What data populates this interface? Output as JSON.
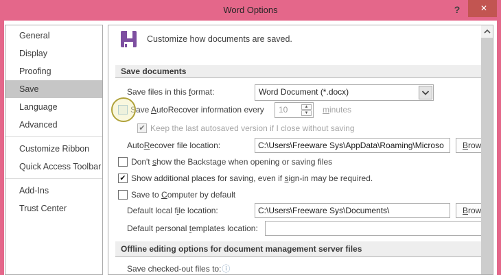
{
  "window": {
    "title": "Word Options"
  },
  "icons": {
    "help": "?",
    "close": "✕",
    "info": "ⓘ",
    "check": "✔",
    "spinner_up": "▲",
    "spinner_down": "▼"
  },
  "colors": {
    "titlebar_pink": "#e4678a",
    "close_button_red": "#c25551",
    "save_icon_purple": "#7d4fa0",
    "selected_item_gray": "#c6c6c6",
    "section_bar_gray": "#eeeeee",
    "highlight_circle_border": "#b0a23a",
    "highlight_circle_fill": "#f4f0c3",
    "highlighted_checkbox_border": "#6ba7d9"
  },
  "sidebar": {
    "items": [
      {
        "label": "General",
        "selected": false
      },
      {
        "label": "Display",
        "selected": false
      },
      {
        "label": "Proofing",
        "selected": false
      },
      {
        "label": "Save",
        "selected": true
      },
      {
        "label": "Language",
        "selected": false
      },
      {
        "label": "Advanced",
        "selected": false
      },
      {
        "label": "Customize Ribbon",
        "selected": false
      },
      {
        "label": "Quick Access Toolbar",
        "selected": false
      },
      {
        "label": "Add-Ins",
        "selected": false
      },
      {
        "label": "Trust Center",
        "selected": false
      }
    ]
  },
  "content": {
    "page_header": "Customize how documents are saved.",
    "save_section": {
      "title": "Save documents",
      "format_label": {
        "pre": "Save files in this ",
        "key": "f",
        "post": "ormat:"
      },
      "format_value": "Word Document (*.docx)",
      "autorecover": {
        "pre": "Save ",
        "key": "A",
        "post": "utoRecover information every",
        "value": "10",
        "minutes_key": "m",
        "minutes_post": "inutes",
        "checked": false
      },
      "keep_autosave_label": "Keep the last autosaved version if I close without saving",
      "keep_autosave_checked": true,
      "ar_location": {
        "pre": "Auto",
        "key": "R",
        "post": "ecover file location:",
        "value": "C:\\Users\\Freeware Sys\\AppData\\Roaming\\Microso"
      },
      "browse_button": {
        "key": "B",
        "post": "rowse..."
      },
      "backstage": {
        "pre": "Don't ",
        "key": "s",
        "post": "how the Backstage when opening or saving files",
        "checked": false
      },
      "places": {
        "pre": "Show additional places for saving, even if ",
        "key": "s",
        "post": "ign-in may be required.",
        "checked": true
      },
      "computer": {
        "pre": "Save to ",
        "key": "C",
        "post": "omputer by default",
        "checked": false
      },
      "local_location": {
        "pre": "Default local f",
        "key": "i",
        "post": "le location:",
        "value": "C:\\Users\\Freeware Sys\\Documents\\"
      },
      "templates_location": {
        "pre": "Default personal ",
        "key": "t",
        "post": "emplates location:",
        "value": ""
      }
    },
    "offline_section": {
      "title": "Offline editing options for document management server files",
      "checked_out_label": "Save checked-out files to:"
    }
  }
}
